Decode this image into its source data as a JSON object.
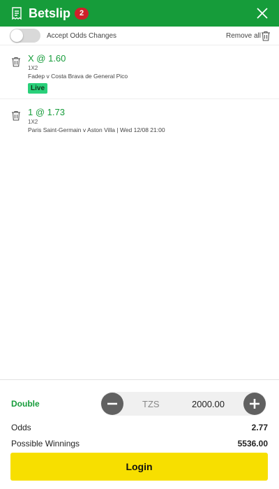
{
  "header": {
    "title": "Betslip",
    "badge_count": "2",
    "icons": {
      "receipt": "receipt-icon",
      "close": "close-icon"
    },
    "background": "#169c3a"
  },
  "options": {
    "accept_label": "Accept Odds Changes",
    "accept_toggle_on": false,
    "remove_all_label": "Remove all"
  },
  "bets": [
    {
      "selection": "X @ 1.60",
      "market": "1X2",
      "event": "Fadep v Costa Brava de General Pico",
      "badge": "Live"
    },
    {
      "selection": "1 @ 1.73",
      "market": "1X2",
      "event": "Paris Saint-Germain v Aston Villa | Wed 12/08 21:00"
    }
  ],
  "footer": {
    "bet_type": "Double",
    "stake": {
      "currency": "TZS",
      "amount": "2000.00"
    },
    "odds_label": "Odds",
    "odds_value": "2.77",
    "winnings_label": "Possible Winnings",
    "winnings_value": "5536.00",
    "login_label": "Login"
  },
  "colors": {
    "brand_green": "#169c3a",
    "live_badge": "#2ad07a",
    "login_button": "#f7df00",
    "badge_red": "#d0202a"
  }
}
